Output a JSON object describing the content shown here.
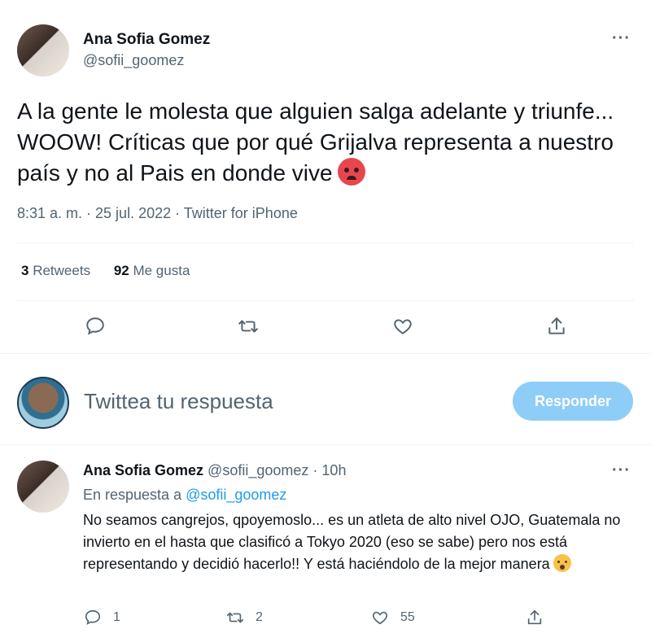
{
  "tweet": {
    "author_name": "Ana Sofia Gomez",
    "author_handle": "@sofii_goomez",
    "more_label": "···",
    "text": "A la gente le molesta que alguien salga adelante y triunfe... WOOW! Críticas que por qué Grijalva representa a nuestro país y no al Pais en donde vive",
    "emoji": "hot-face-emoji",
    "meta": "8:31 a. m. · 25 jul. 2022 · Twitter for iPhone",
    "retweets_count": "3",
    "retweets_label": "Retweets",
    "likes_count": "92",
    "likes_label": "Me gusta",
    "actions": [
      "reply-icon",
      "retweet-icon",
      "like-icon",
      "share-icon"
    ]
  },
  "compose": {
    "placeholder": "Twittea tu respuesta",
    "button_label": "Responder"
  },
  "reply": {
    "author_name": "Ana Sofia Gomez",
    "author_handle": "@sofii_goomez",
    "separator": "·",
    "time": "10h",
    "more_label": "···",
    "in_reply_prefix": "En respuesta a",
    "in_reply_handle": "@sofii_goomez",
    "text": "No seamos cangrejos, qpoyemoslo... es un atleta de alto nivel OJO, Guatemala no invierto en el hasta que clasificó a Tokyo 2020 (eso se sabe) pero nos está representando y decidió hacerlo!! Y está haciéndolo de la mejor manera",
    "emoji": "exploding-head-emoji",
    "reply_count": "1",
    "retweet_count": "2",
    "like_count": "55"
  },
  "colors": {
    "text": "#0f1419",
    "secondary": "#536471",
    "accent": "#1d9bf0",
    "button_disabled": "#8ecdf8",
    "divider": "#eff3f4"
  }
}
